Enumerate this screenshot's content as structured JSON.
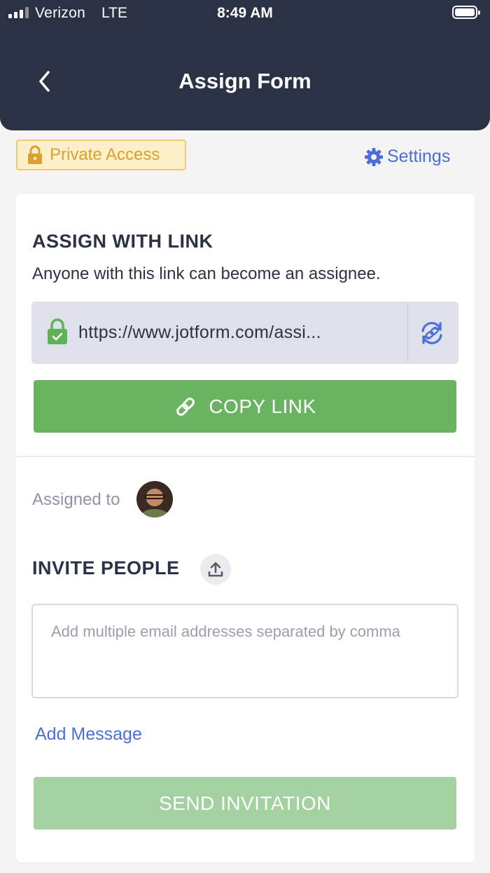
{
  "status_bar": {
    "carrier": "Verizon",
    "network": "LTE",
    "time": "8:49 AM"
  },
  "header": {
    "title": "Assign Form"
  },
  "access": {
    "badge_label": "Private Access",
    "settings_label": "Settings"
  },
  "assign_link": {
    "title": "ASSIGN WITH LINK",
    "description": "Anyone with this link can become an assignee.",
    "url": "https://www.jotform.com/assi...",
    "copy_button": "COPY LINK"
  },
  "assigned": {
    "label": "Assigned to"
  },
  "invite": {
    "title": "INVITE PEOPLE",
    "email_placeholder": "Add multiple email addresses separated by comma",
    "add_message": "Add Message",
    "send_button": "SEND INVITATION"
  },
  "colors": {
    "header_bg": "#2b3245",
    "accent_blue": "#4b6fd8",
    "copy_green": "#6ab360",
    "send_green_disabled": "#a4d1a0",
    "badge_gold": "#d9a033"
  },
  "icons": [
    "back-chevron-icon",
    "lock-icon",
    "gear-icon",
    "secure-lock-icon",
    "refresh-link-icon",
    "chain-link-icon",
    "upload-icon"
  ]
}
